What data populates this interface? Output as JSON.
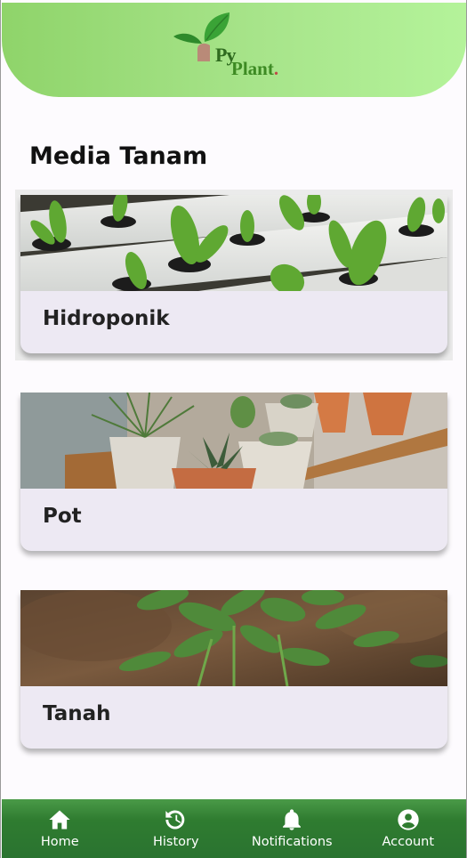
{
  "app": {
    "logo_text_py": "Py",
    "logo_text_plant": "Plant",
    "logo_dot": "."
  },
  "page": {
    "title": "Media Tanam"
  },
  "cards": [
    {
      "label": "Hidroponik",
      "image": "hydroponic-lettuce-image"
    },
    {
      "label": "Pot",
      "image": "potted-succulents-image"
    },
    {
      "label": "Tanah",
      "image": "soil-seedlings-image"
    }
  ],
  "nav": {
    "items": [
      {
        "label": "Home",
        "icon": "home-icon"
      },
      {
        "label": "History",
        "icon": "history-icon"
      },
      {
        "label": "Notifications",
        "icon": "bell-icon"
      },
      {
        "label": "Account",
        "icon": "account-icon"
      }
    ]
  },
  "colors": {
    "header_start": "#8fd46a",
    "header_end": "#b4f39a",
    "nav_bg": "#2f7c30",
    "card_bg": "#ede9f3"
  }
}
